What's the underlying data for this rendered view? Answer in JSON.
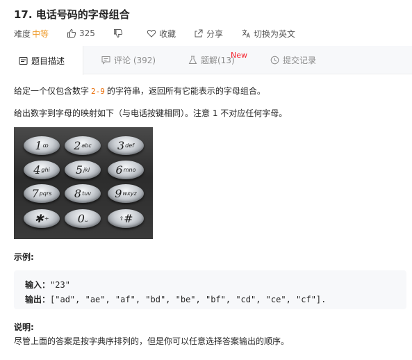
{
  "problem": {
    "title": "17. 电话号码的字母组合",
    "difficulty_label": "难度",
    "difficulty_value": "中等",
    "like_count": "325",
    "favorite_label": "收藏",
    "share_label": "分享",
    "switch_lang_label": "切换为英文"
  },
  "tabs": [
    {
      "label": "题目描述",
      "icon": "description-icon",
      "active": true
    },
    {
      "label": "评论 (392)",
      "icon": "comment-icon",
      "active": false
    },
    {
      "label": "题解(13)",
      "icon": "flask-icon",
      "active": false,
      "badge": "New"
    },
    {
      "label": "提交记录",
      "icon": "clock-icon",
      "active": false
    }
  ],
  "description": {
    "p1_before": "给定一个仅包含数字",
    "p1_code": "2-9",
    "p1_after": "的字符串，返回所有它能表示的字母组合。",
    "p2": "给出数字到字母的映射如下（与电话按键相同）。注意 1 不对应任何字母。"
  },
  "keypad": [
    {
      "digit": "1",
      "letters": "ꝏ"
    },
    {
      "digit": "2",
      "letters": "abc"
    },
    {
      "digit": "3",
      "letters": "def"
    },
    {
      "digit": "4",
      "letters": "ghi"
    },
    {
      "digit": "5",
      "letters": "jkl"
    },
    {
      "digit": "6",
      "letters": "mno"
    },
    {
      "digit": "7",
      "letters": "pqrs"
    },
    {
      "digit": "8",
      "letters": "tuv"
    },
    {
      "digit": "9",
      "letters": "wxyz"
    },
    {
      "digit": "✱",
      "letters": "+"
    },
    {
      "digit": "0",
      "letters": "⎵"
    },
    {
      "digit": "#",
      "letters": "⇧"
    }
  ],
  "example": {
    "title": "示例:",
    "input_label": "输入：",
    "input_value": "\"23\"",
    "output_label": "输出：",
    "output_value": "[\"ad\", \"ae\", \"af\", \"bd\", \"be\", \"bf\", \"cd\", \"ce\", \"cf\"]."
  },
  "note": {
    "title": "说明:",
    "text": "尽管上面的答案是按字典序排列的，但是你可以任意选择答案输出的顺序。"
  },
  "colors": {
    "difficulty_medium": "#ef9b2a",
    "new_badge": "#f5222d",
    "code_accent": "#e96900"
  }
}
